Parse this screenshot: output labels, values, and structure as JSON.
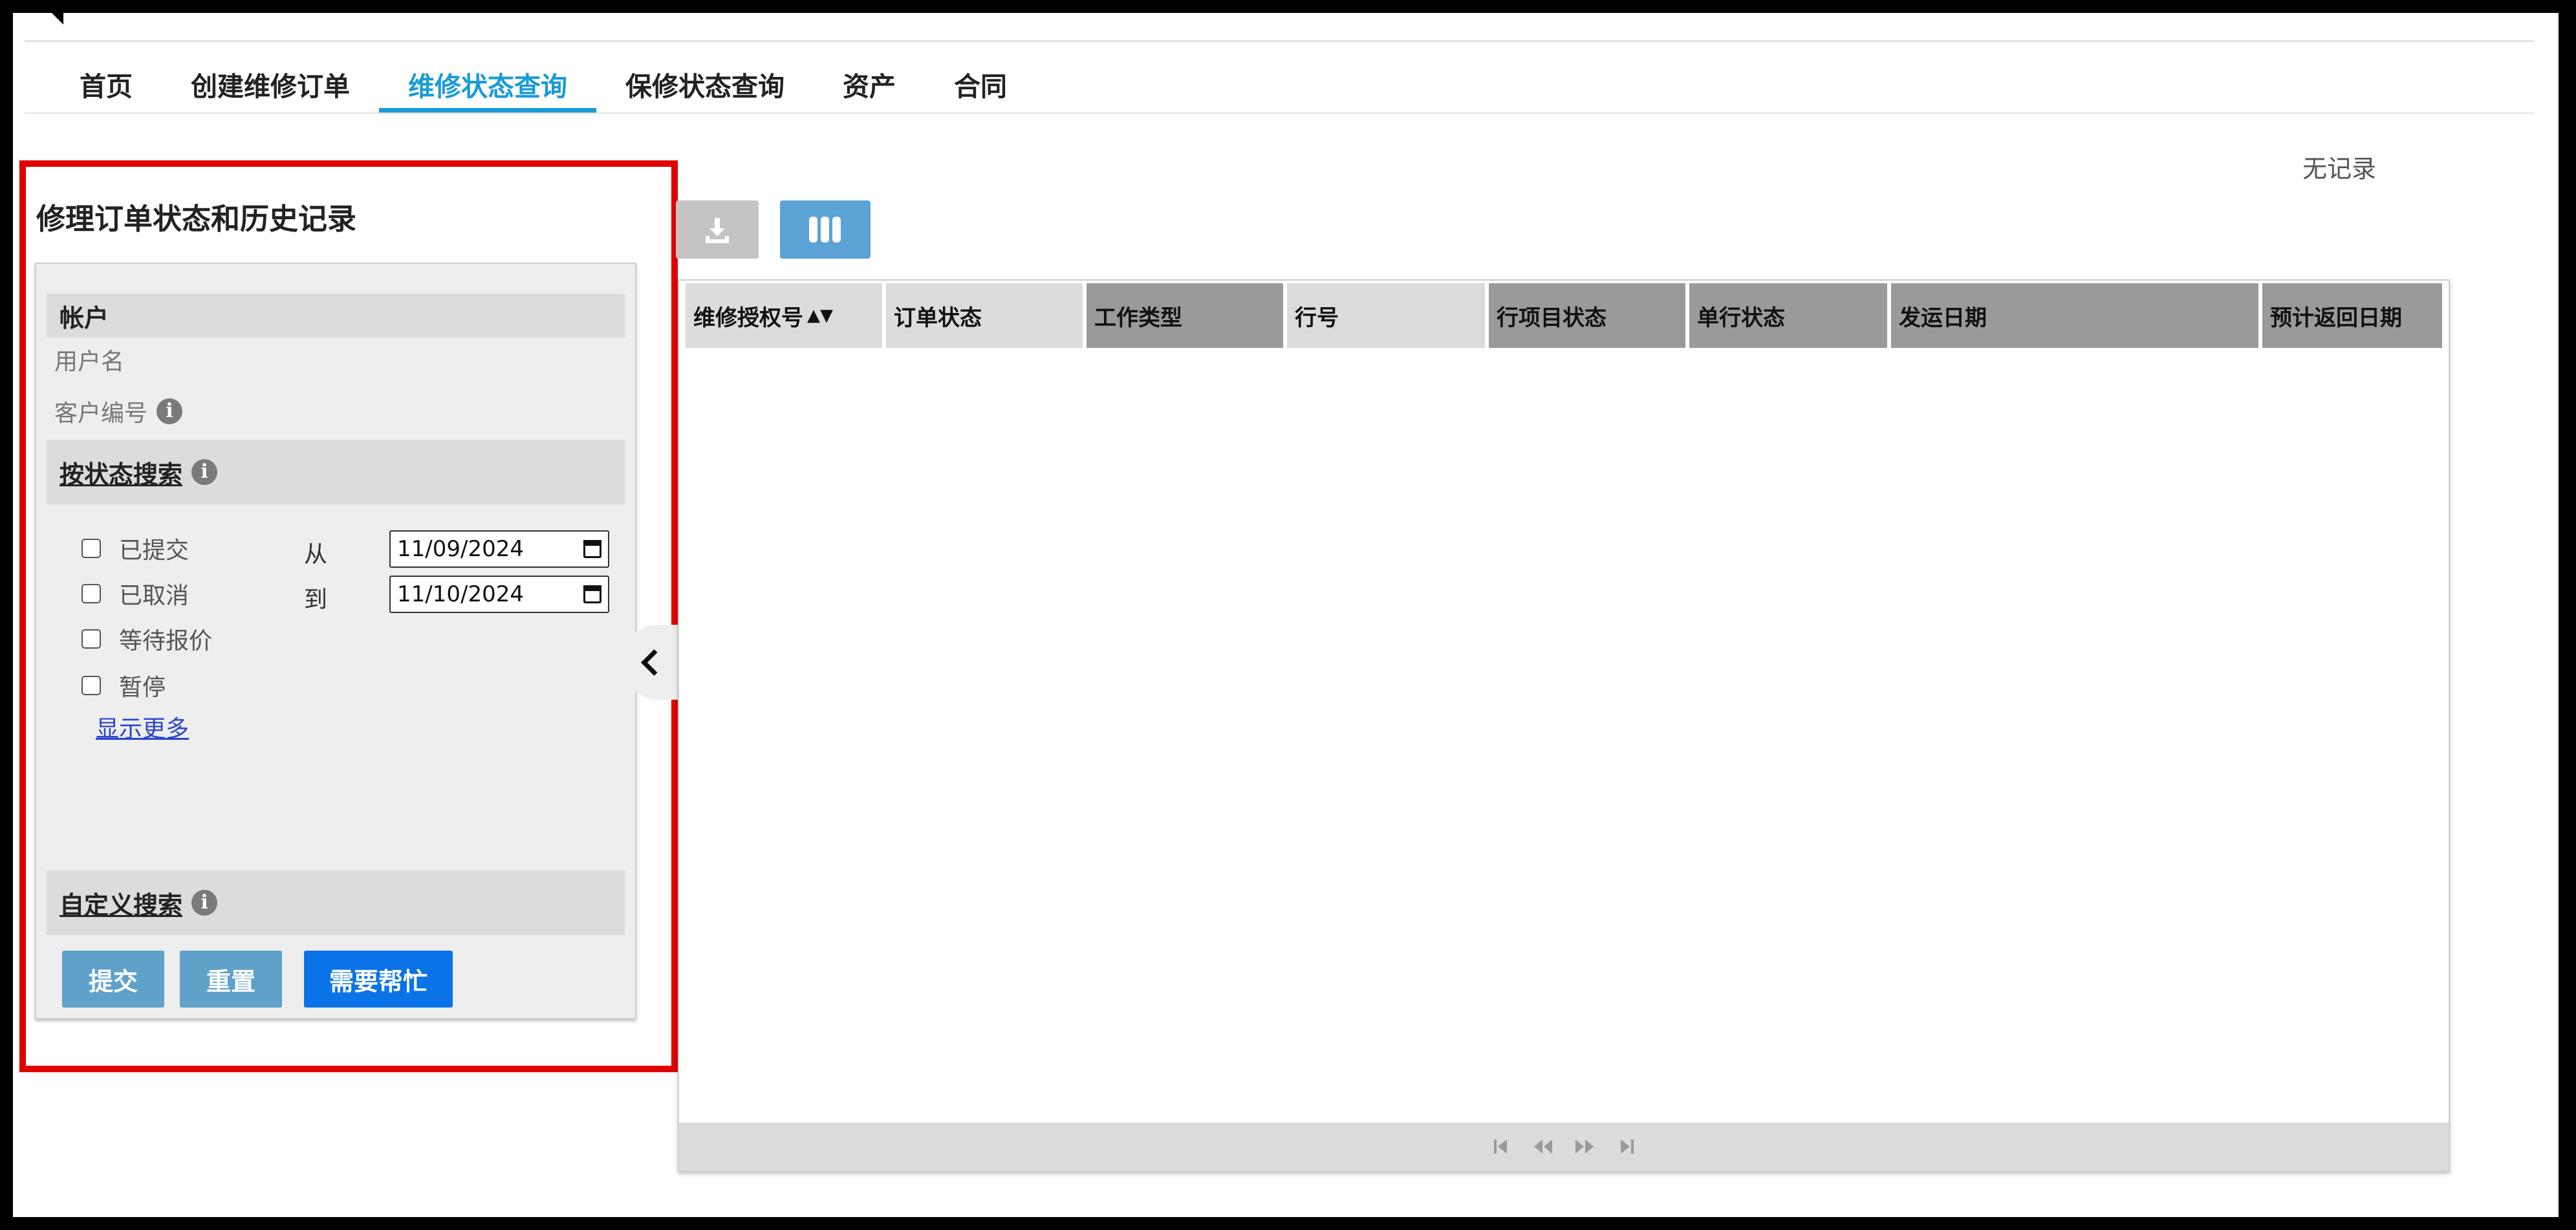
{
  "nav": {
    "items": [
      {
        "label": "首页",
        "active": false
      },
      {
        "label": "创建维修订单",
        "active": false
      },
      {
        "label": "维修状态查询",
        "active": true
      },
      {
        "label": "保修状态查询",
        "active": false
      },
      {
        "label": "资产",
        "active": false
      },
      {
        "label": "合同",
        "active": false
      }
    ]
  },
  "results": {
    "no_records": "无记录"
  },
  "panel": {
    "title": "修理订单状态和历史记录",
    "account": {
      "section_label": "帐户",
      "username_label": "用户名",
      "customer_number_label": "客户编号",
      "info_icon": "info-icon"
    },
    "status_search": {
      "section_label": "按状态搜索",
      "statuses": [
        {
          "label": "已提交",
          "checked": false
        },
        {
          "label": "已取消",
          "checked": false
        },
        {
          "label": "等待报价",
          "checked": false
        },
        {
          "label": "暂停",
          "checked": false
        }
      ],
      "from_label": "从",
      "to_label": "到",
      "from_date": "11/09/2024",
      "to_date": "11/10/2024",
      "show_more": "显示更多"
    },
    "custom_search": {
      "section_label": "自定义搜索"
    },
    "buttons": {
      "submit": "提交",
      "reset": "重置",
      "help": "需要帮忙"
    }
  },
  "toolbar": {
    "download_icon": "download-icon",
    "columns_icon": "columns-icon"
  },
  "table": {
    "columns": [
      {
        "label": "维修授权号",
        "sort": "▲▼"
      },
      {
        "label": "订单状态"
      },
      {
        "label": "工作类型"
      },
      {
        "label": "行号"
      },
      {
        "label": "行项目状态"
      },
      {
        "label": "单行状态"
      },
      {
        "label": "发运日期"
      },
      {
        "label": "预计返回日期"
      }
    ],
    "rows": []
  },
  "colors": {
    "accent": "#1a9bd7",
    "highlight_frame": "#e00000",
    "primary_button": "#0a73e8",
    "secondary_button": "#5fa1c9"
  }
}
